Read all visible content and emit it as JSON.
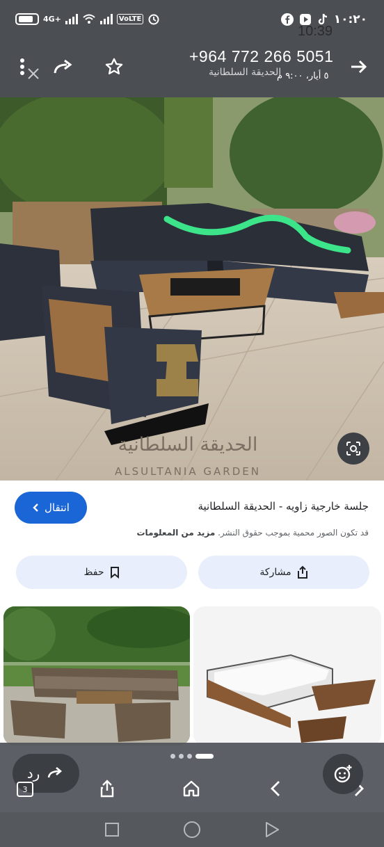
{
  "status_bar": {
    "network": "4G+",
    "volte": "VoLTE",
    "time": "١٠:٢٠",
    "ghost_time": "10:39"
  },
  "toolbar": {
    "phone": "+964 772 266 5051",
    "page_title": "الحديقة السلطانية",
    "date": "٥ أيار، ٩:٠٠ م"
  },
  "hero_image": {
    "watermark_ar": "الحديقة السلطانية",
    "watermark_en": "ALSULTANIA GARDEN"
  },
  "result": {
    "title": "جلسة خارجية زاويه - الحديقة السلطانية",
    "copyright_note": "قد تكون الصور محمية بموجب حقوق النشر.",
    "more_info": "مزيد من المعلومات",
    "visit_label": "انتقال"
  },
  "actions": {
    "save_label": "حفظ",
    "share_label": "مشاركة"
  },
  "bottom_bar": {
    "reply_label": "رد",
    "tab_count": "3"
  },
  "colors": {
    "chrome": "#4b4e52",
    "accent_blue": "#1a66d6",
    "pill_bg": "#e8eefb"
  }
}
